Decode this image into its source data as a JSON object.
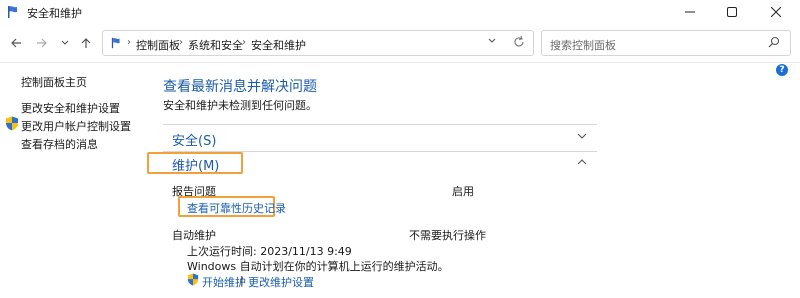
{
  "window": {
    "title": "安全和维护",
    "minimize_icon": "minimize-icon",
    "maximize_icon": "maximize-icon",
    "close_icon": "close-icon"
  },
  "nav": {
    "breadcrumbs": [
      "控制面板",
      "系统和安全",
      "安全和维护"
    ],
    "search_placeholder": "搜索控制面板"
  },
  "sidebar": {
    "items": [
      {
        "label": "控制面板主页"
      },
      {
        "label": "更改安全和维护设置"
      },
      {
        "label": "更改用户帐户控制设置"
      },
      {
        "label": "查看存档的消息"
      }
    ]
  },
  "main": {
    "title": "查看最新消息并解决问题",
    "subtitle": "安全和维护未检测到任何问题。",
    "security_header": "安全(S)",
    "maintenance_header": "维护(M)",
    "report_problems_label": "报告问题",
    "report_problems_status": "启用",
    "view_history_link": "查看可靠性历史记录",
    "auto_maintenance_label": "自动维护",
    "auto_maintenance_status": "不需要执行操作",
    "last_run": "上次运行时间: 2023/11/13 9:49",
    "auto_schedule_desc": "Windows 自动计划在你的计算机上运行的维护活动。",
    "start_maintenance_link": "开始维护",
    "separator": "|",
    "change_settings_link": "更改维护设置"
  },
  "colors": {
    "link_blue": "#1c5ca9",
    "highlight_orange": "#f2a13a"
  }
}
